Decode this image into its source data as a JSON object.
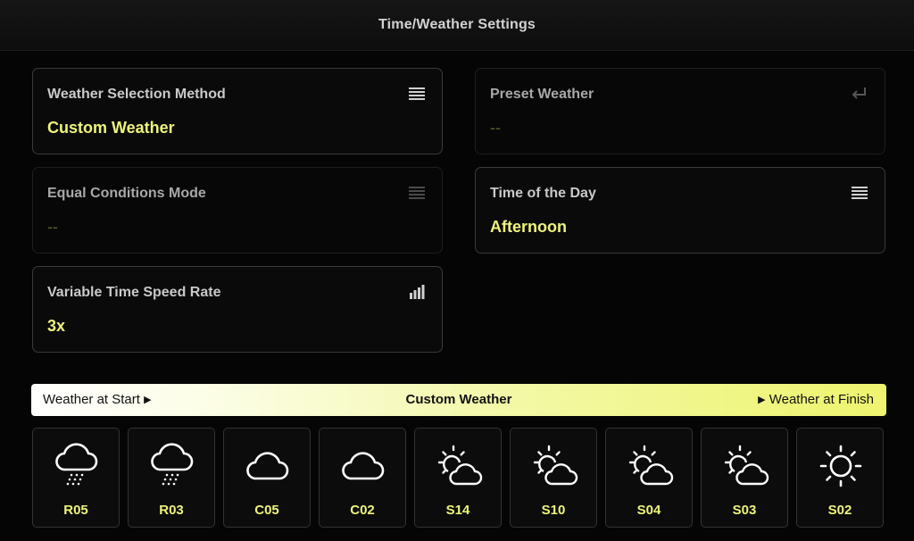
{
  "header": {
    "title": "Time/Weather Settings"
  },
  "settings": {
    "weather_method": {
      "label": "Weather Selection Method",
      "value": "Custom Weather",
      "icon": "list-icon"
    },
    "preset_weather": {
      "label": "Preset Weather",
      "value": "--",
      "icon": "enter-icon"
    },
    "equal_conditions": {
      "label": "Equal Conditions Mode",
      "value": "--",
      "icon": "list-icon"
    },
    "time_of_day": {
      "label": "Time of the Day",
      "value": "Afternoon",
      "icon": "list-icon"
    },
    "time_speed": {
      "label": "Variable Time Speed Rate",
      "value": "3x",
      "icon": "signal-bars-icon"
    }
  },
  "banner": {
    "start_label": "Weather at Start",
    "center_label": "Custom Weather",
    "finish_label": "Weather at Finish",
    "start_arrow": "▶",
    "finish_arrow": "▶"
  },
  "weather_slots": [
    {
      "code": "R05",
      "icon": "rain-cloud-icon"
    },
    {
      "code": "R03",
      "icon": "rain-cloud-icon"
    },
    {
      "code": "C05",
      "icon": "cloud-icon"
    },
    {
      "code": "C02",
      "icon": "cloud-icon"
    },
    {
      "code": "S14",
      "icon": "sun-cloud-icon"
    },
    {
      "code": "S10",
      "icon": "sun-cloud-icon"
    },
    {
      "code": "S04",
      "icon": "sun-cloud-icon"
    },
    {
      "code": "S03",
      "icon": "sun-cloud-icon"
    },
    {
      "code": "S02",
      "icon": "sun-icon"
    }
  ],
  "colors": {
    "accent": "#eef47a",
    "background": "#050505",
    "border": "#3a3a3a"
  }
}
